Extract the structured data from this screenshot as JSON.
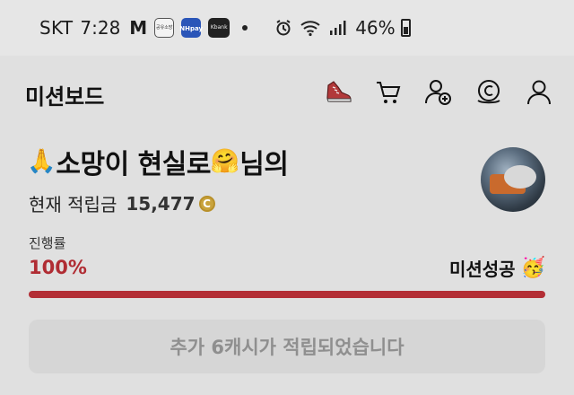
{
  "status_bar": {
    "carrier": "SKT",
    "time": "7:28",
    "m_icon": "M",
    "app_icon_1": "공유소방",
    "nh_pay_line1": "NH",
    "nh_pay_line2": "pay",
    "kbank": "Kbank",
    "battery_pct": "46%",
    "icons": [
      "alarm-icon",
      "wifi-icon",
      "signal-icon",
      "battery-icon"
    ]
  },
  "header": {
    "title": "미션보드",
    "icons": [
      "shoe-icon",
      "cart-icon",
      "add-friend-icon",
      "cash-icon",
      "profile-icon"
    ]
  },
  "user": {
    "prefix_emoji": "🙏",
    "name_part1": "소망이 현실로",
    "hug_emoji": "🤗",
    "name_suffix": "님의",
    "points_label": "현재 적립금",
    "points_value": "15,477",
    "coin_symbol": "C"
  },
  "progress": {
    "label": "진행률",
    "percent_text": "100%",
    "percent_value": 100,
    "status_text": "미션성공",
    "status_emoji": "🥳"
  },
  "result_button": {
    "label": "추가 6캐시가 적립되었습니다"
  },
  "colors": {
    "accent_red": "#b32e35",
    "coin_gold": "#c9a33c"
  }
}
